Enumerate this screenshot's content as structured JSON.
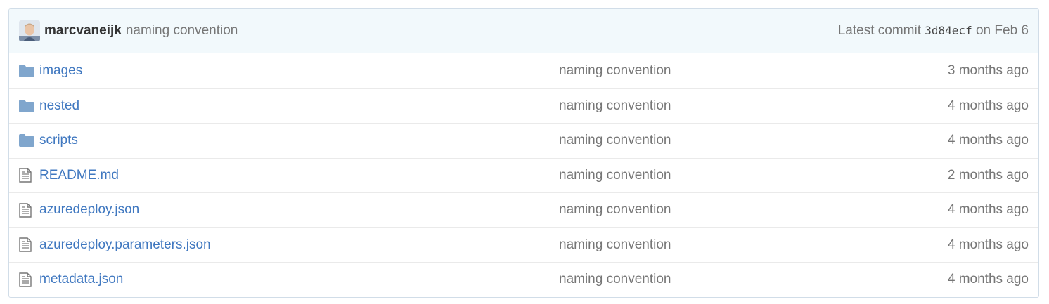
{
  "commit": {
    "author": "marcvaneijk",
    "message": "naming convention",
    "latest_label": "Latest commit",
    "sha": "3d84ecf",
    "on_label": "on",
    "date": "Feb 6"
  },
  "colors": {
    "link": "#4078c0",
    "folder_icon": "#80a6cd",
    "header_bg": "#f2f9fc",
    "muted_text": "#767676"
  },
  "files": [
    {
      "type": "directory",
      "icon": "folder-icon",
      "name": "images",
      "message": "naming convention",
      "age": "3 months ago"
    },
    {
      "type": "directory",
      "icon": "folder-icon",
      "name": "nested",
      "message": "naming convention",
      "age": "4 months ago"
    },
    {
      "type": "directory",
      "icon": "folder-icon",
      "name": "scripts",
      "message": "naming convention",
      "age": "4 months ago"
    },
    {
      "type": "file",
      "icon": "file-text-icon",
      "name": "README.md",
      "message": "naming convention",
      "age": "2 months ago"
    },
    {
      "type": "file",
      "icon": "file-text-icon",
      "name": "azuredeploy.json",
      "message": "naming convention",
      "age": "4 months ago"
    },
    {
      "type": "file",
      "icon": "file-text-icon",
      "name": "azuredeploy.parameters.json",
      "message": "naming convention",
      "age": "4 months ago"
    },
    {
      "type": "file",
      "icon": "file-text-icon",
      "name": "metadata.json",
      "message": "naming convention",
      "age": "4 months ago"
    }
  ]
}
